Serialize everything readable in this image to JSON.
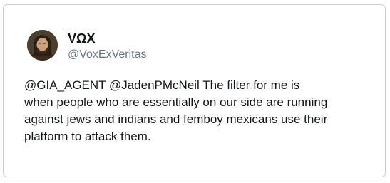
{
  "tweet": {
    "author": {
      "display_name": "VΩX",
      "handle": "@VoxExVeritas"
    },
    "text_lines": [
      "@GIA_AGENT @JadenPMcNeil The filter for me is",
      "when people who are essentially on our side are running",
      "against jews and indians and femboy mexicans use their",
      "platform to attack them."
    ]
  },
  "icons": {
    "avatar": "profile-photo"
  },
  "colors": {
    "text_primary": "#14171a",
    "text_secondary": "#657786",
    "border": "#c9ced3",
    "background": "#ffffff"
  }
}
